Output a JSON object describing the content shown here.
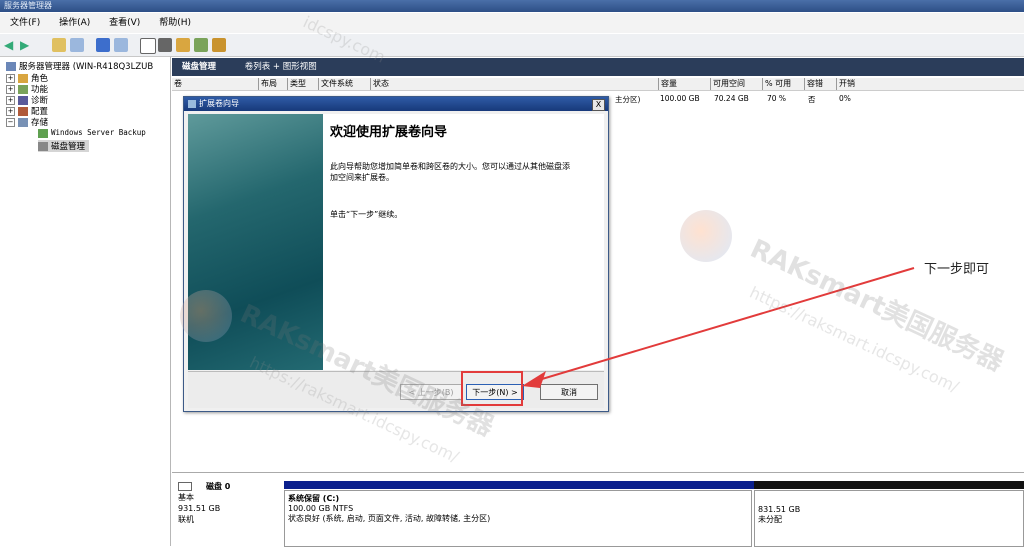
{
  "window": {
    "title": "服务器管理器"
  },
  "menu": [
    "文件(F)",
    "操作(A)",
    "查看(V)",
    "帮助(H)"
  ],
  "tree": {
    "root": "服务器管理器 (WIN-R418Q3LZUB",
    "items": [
      "角色",
      "功能",
      "诊断",
      "配置",
      "存储"
    ],
    "storage_children": [
      "Windows Server Backup",
      "磁盘管理"
    ]
  },
  "pane": {
    "title": "磁盘管理",
    "view": "卷列表 + 图形视图"
  },
  "columns": [
    "卷",
    "布局",
    "类型",
    "文件系统",
    "状态",
    "容量",
    "可用空间",
    "% 可用",
    "容错",
    "开销"
  ],
  "volume_row": {
    "status_tail": "主分区)",
    "capacity": "100.00 GB",
    "free": "70.24 GB",
    "pct_free": "70 %",
    "fault": "否",
    "overhead": "0%"
  },
  "dialog": {
    "title": "扩展卷向导",
    "close": "X",
    "heading": "欢迎使用扩展卷向导",
    "para1": "此向导帮助您增加简单卷和跨区卷的大小。您可以通过从其他磁盘添加空间来扩展卷。",
    "para2": "单击“下一步”继续。",
    "back": "< 上一步(B)",
    "next": "下一步(N) >",
    "cancel": "取消"
  },
  "annotation": "下一步即可",
  "disk": {
    "name": "磁盘 0",
    "type": "基本",
    "size": "931.51 GB",
    "state": "联机",
    "vol1_name": "系统保留  (C:)",
    "vol1_size": "100.00 GB NTFS",
    "vol1_status": "状态良好 (系统, 启动, 页面文件, 活动, 故障转储, 主分区)",
    "vol2_size": "831.51 GB",
    "vol2_status": "未分配"
  },
  "watermarks": [
    "RAKsmart美国服务器",
    "https://raksmart.idcspy.com/",
    "idcspy.com"
  ],
  "colors": {
    "highlight": "#e23b3b",
    "dialog_title": "#1f4a96",
    "disk_bar": "#0a1f8c"
  }
}
